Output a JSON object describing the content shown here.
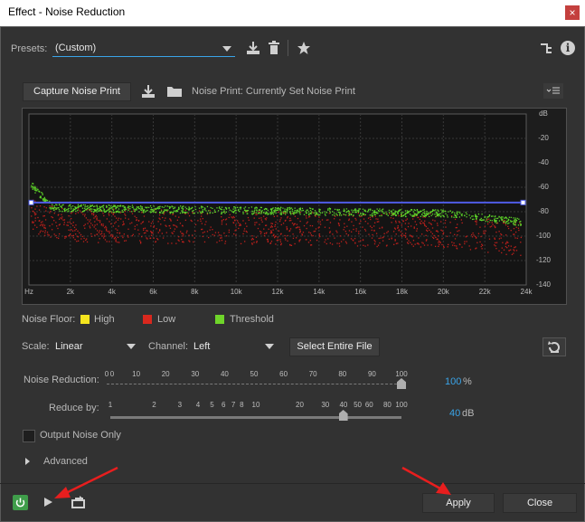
{
  "window": {
    "title": "Effect - Noise Reduction",
    "close_glyph": "×"
  },
  "presets": {
    "label": "Presets:",
    "value": "(Custom)"
  },
  "capture": {
    "button_label": "Capture Noise Print",
    "noise_print_text": "Noise Print: Currently Set Noise Print"
  },
  "graph": {
    "db_ticks": [
      "dB",
      "-20",
      "-40",
      "-60",
      "-80",
      "-100",
      "-120",
      "-140"
    ],
    "hz_ticks": [
      "Hz",
      "2k",
      "4k",
      "6k",
      "8k",
      "10k",
      "12k",
      "14k",
      "16k",
      "18k",
      "20k",
      "22k",
      "24k"
    ]
  },
  "legend": {
    "label": "Noise Floor:",
    "high": "High",
    "low": "Low",
    "threshold": "Threshold",
    "high_color": "#f5e51e",
    "low_color": "#d9281e",
    "threshold_color": "#6fd52a"
  },
  "scale": {
    "label": "Scale:",
    "value": "Linear"
  },
  "channel": {
    "label": "Channel:",
    "value": "Left"
  },
  "select_entire_file_label": "Select Entire File",
  "noise_reduction": {
    "label": "Noise Reduction:",
    "value": "100",
    "unit": "%",
    "level": 1.0,
    "ticks": [
      "0",
      "0",
      "10",
      "20",
      "30",
      "40",
      "50",
      "60",
      "70",
      "80",
      "90",
      "100"
    ]
  },
  "reduce_by": {
    "label": "Reduce by:",
    "value": "40",
    "unit": "dB",
    "level": 0.8,
    "ticks": [
      "1",
      "2",
      "3",
      "4",
      "5",
      "6",
      "7",
      "8",
      "10",
      "20",
      "30",
      "40",
      "50",
      "60",
      "80",
      "100"
    ]
  },
  "output_noise_only": {
    "label": "Output Noise Only",
    "checked": false
  },
  "advanced": {
    "label": "Advanced"
  },
  "footer": {
    "apply_label": "Apply",
    "close_label": "Close"
  },
  "colors": {
    "accent": "#3aa4e8",
    "annotation_arrow": "#e81e1e",
    "power": "#3f9d4a"
  }
}
